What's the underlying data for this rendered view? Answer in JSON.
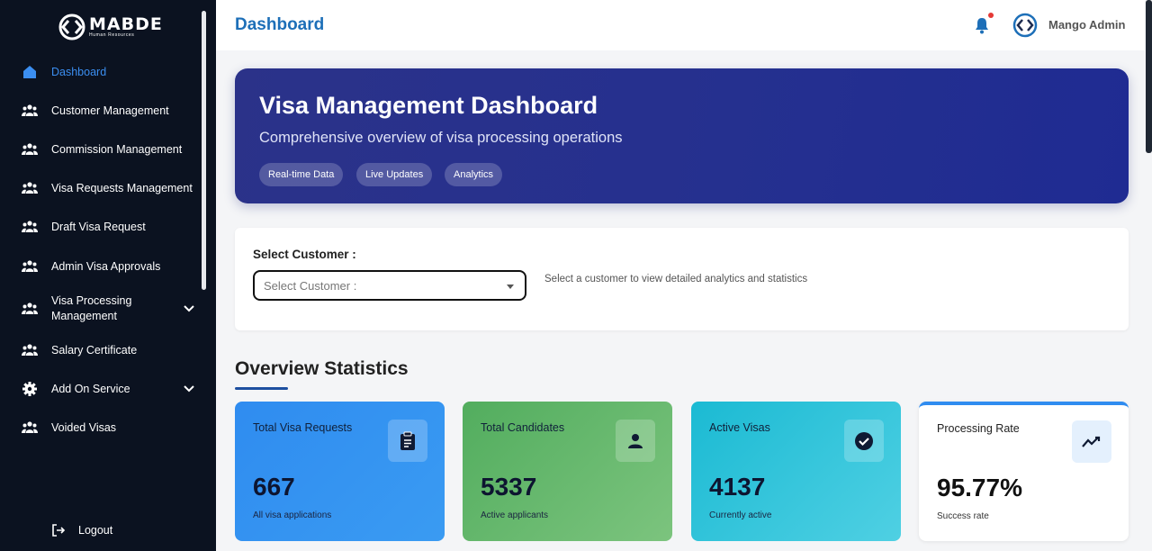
{
  "brand": {
    "name": "MABDE",
    "tagline": "Human Resources"
  },
  "sidebar": {
    "items": [
      {
        "label": "Dashboard",
        "icon": "home-icon",
        "active": true
      },
      {
        "label": "Customer Management",
        "icon": "group-icon"
      },
      {
        "label": "Commission Management",
        "icon": "group-icon"
      },
      {
        "label": "Visa Requests Management",
        "icon": "group-icon"
      },
      {
        "label": "Draft Visa Request",
        "icon": "group-icon"
      },
      {
        "label": "Admin Visa Approvals",
        "icon": "group-icon"
      },
      {
        "label": "Visa Processing Management",
        "icon": "group-icon",
        "expandable": true
      },
      {
        "label": "Salary Certificate",
        "icon": "group-icon"
      },
      {
        "label": "Add On Service",
        "icon": "gear-icon",
        "expandable": true
      },
      {
        "label": "Voided Visas",
        "icon": "group-icon"
      }
    ],
    "logout": "Logout"
  },
  "header": {
    "title": "Dashboard",
    "user": "Mango Admin"
  },
  "hero": {
    "title": "Visa Management Dashboard",
    "subtitle": "Comprehensive overview of visa processing operations",
    "chips": [
      "Real-time Data",
      "Live Updates",
      "Analytics"
    ]
  },
  "customer_select": {
    "label": "Select Customer :",
    "placeholder": "Select Customer :",
    "hint": "Select a customer to view detailed analytics and statistics"
  },
  "overview": {
    "title": "Overview Statistics",
    "stats": [
      {
        "label": "Total Visa Requests",
        "value": "667",
        "caption": "All visa applications",
        "icon": "clipboard-icon"
      },
      {
        "label": "Total Candidates",
        "value": "5337",
        "caption": "Active applicants",
        "icon": "person-icon"
      },
      {
        "label": "Active Visas",
        "value": "4137",
        "caption": "Currently active",
        "icon": "check-circle-icon"
      },
      {
        "label": "Processing Rate",
        "value": "95.77%",
        "caption": "Success rate",
        "icon": "trend-icon"
      }
    ]
  },
  "colors": {
    "accent": "#1d6fb8",
    "sidebar": "#0b1220",
    "hero": "#25308f"
  }
}
